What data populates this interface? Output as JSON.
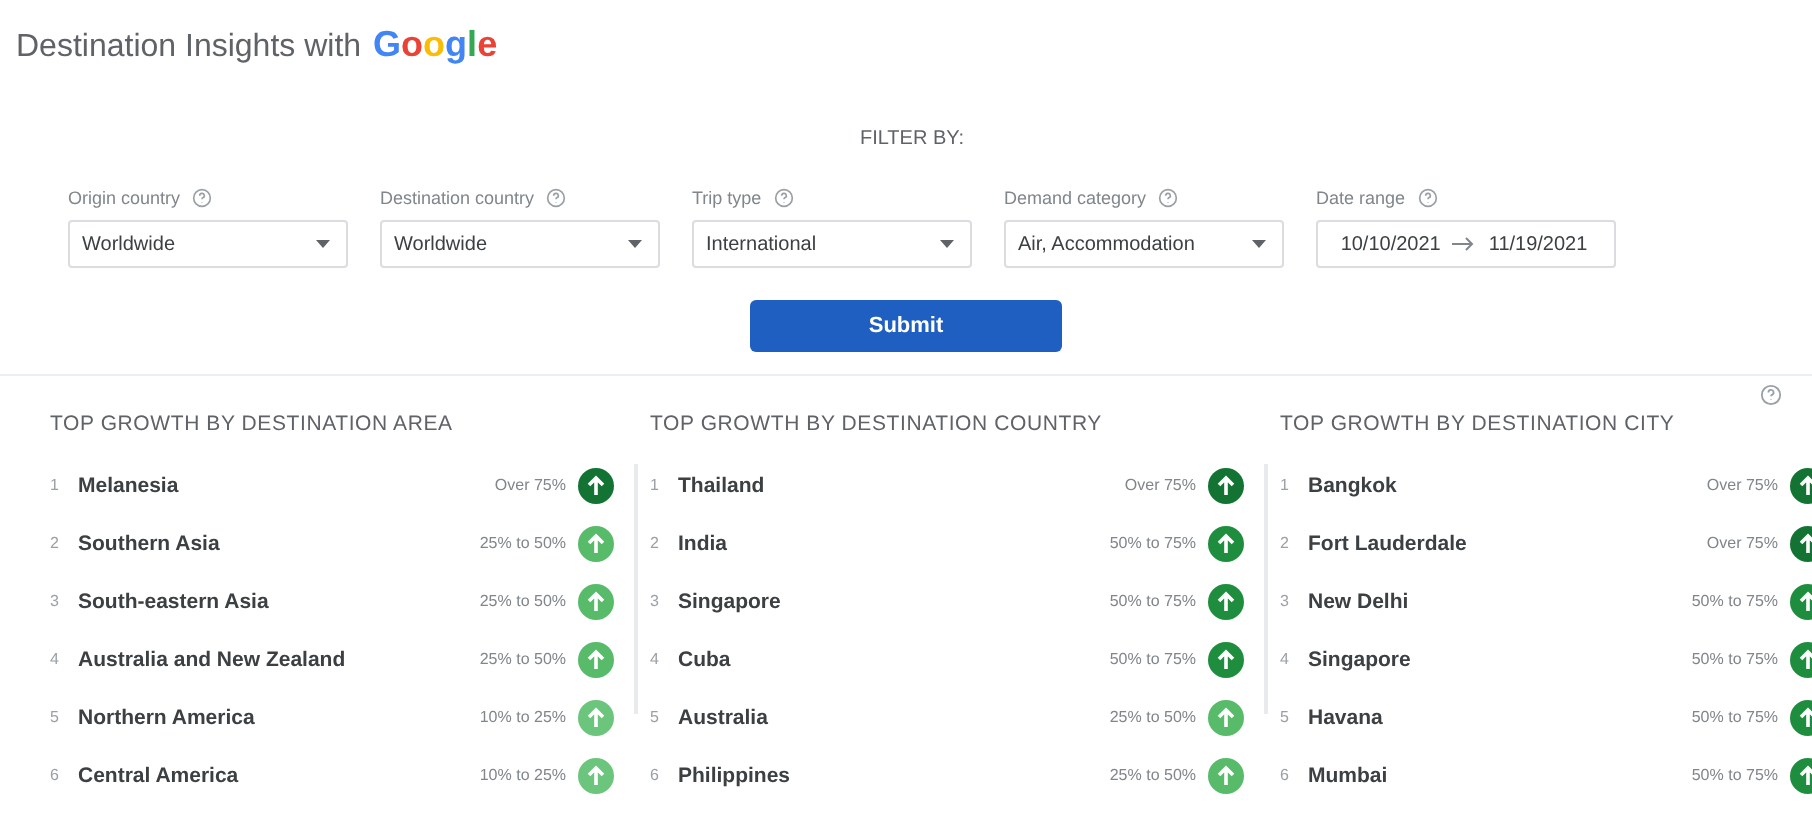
{
  "header": {
    "title": "Destination Insights with",
    "brand": "Google"
  },
  "filter": {
    "label": "FILTER BY:",
    "fields": [
      {
        "label": "Origin country",
        "value": "Worldwide",
        "kind": "select"
      },
      {
        "label": "Destination country",
        "value": "Worldwide",
        "kind": "select"
      },
      {
        "label": "Trip type",
        "value": "International",
        "kind": "select"
      },
      {
        "label": "Demand category",
        "value": "Air, Accommodation",
        "kind": "select"
      },
      {
        "label": "Date range",
        "from": "10/10/2021",
        "to": "11/19/2021",
        "kind": "daterange"
      }
    ],
    "submit": "Submit"
  },
  "lists": [
    {
      "title": "TOP GROWTH BY DESTINATION AREA",
      "items": [
        {
          "rank": "1",
          "name": "Melanesia",
          "growth": "Over 75%",
          "color": "#137333"
        },
        {
          "rank": "2",
          "name": "Southern Asia",
          "growth": "25% to 50%",
          "color": "#57bb6a"
        },
        {
          "rank": "3",
          "name": "South-eastern Asia",
          "growth": "25% to 50%",
          "color": "#57bb6a"
        },
        {
          "rank": "4",
          "name": "Australia and New Zealand",
          "growth": "25% to 50%",
          "color": "#57bb6a"
        },
        {
          "rank": "5",
          "name": "Northern America",
          "growth": "10% to 25%",
          "color": "#6cc57c"
        },
        {
          "rank": "6",
          "name": "Central America",
          "growth": "10% to 25%",
          "color": "#6cc57c"
        }
      ]
    },
    {
      "title": "TOP GROWTH BY DESTINATION COUNTRY",
      "items": [
        {
          "rank": "1",
          "name": "Thailand",
          "growth": "Over 75%",
          "color": "#137333"
        },
        {
          "rank": "2",
          "name": "India",
          "growth": "50% to 75%",
          "color": "#1e8e3e"
        },
        {
          "rank": "3",
          "name": "Singapore",
          "growth": "50% to 75%",
          "color": "#1e8e3e"
        },
        {
          "rank": "4",
          "name": "Cuba",
          "growth": "50% to 75%",
          "color": "#1e8e3e"
        },
        {
          "rank": "5",
          "name": "Australia",
          "growth": "25% to 50%",
          "color": "#57bb6a"
        },
        {
          "rank": "6",
          "name": "Philippines",
          "growth": "25% to 50%",
          "color": "#57bb6a"
        }
      ]
    },
    {
      "title": "TOP GROWTH BY DESTINATION CITY",
      "items": [
        {
          "rank": "1",
          "name": "Bangkok",
          "growth": "Over 75%",
          "color": "#137333"
        },
        {
          "rank": "2",
          "name": "Fort Lauderdale",
          "growth": "Over 75%",
          "color": "#137333"
        },
        {
          "rank": "3",
          "name": "New Delhi",
          "growth": "50% to 75%",
          "color": "#1e8e3e"
        },
        {
          "rank": "4",
          "name": "Singapore",
          "growth": "50% to 75%",
          "color": "#1e8e3e"
        },
        {
          "rank": "5",
          "name": "Havana",
          "growth": "50% to 75%",
          "color": "#1e8e3e"
        },
        {
          "rank": "6",
          "name": "Mumbai",
          "growth": "50% to 75%",
          "color": "#1e8e3e"
        }
      ]
    }
  ]
}
